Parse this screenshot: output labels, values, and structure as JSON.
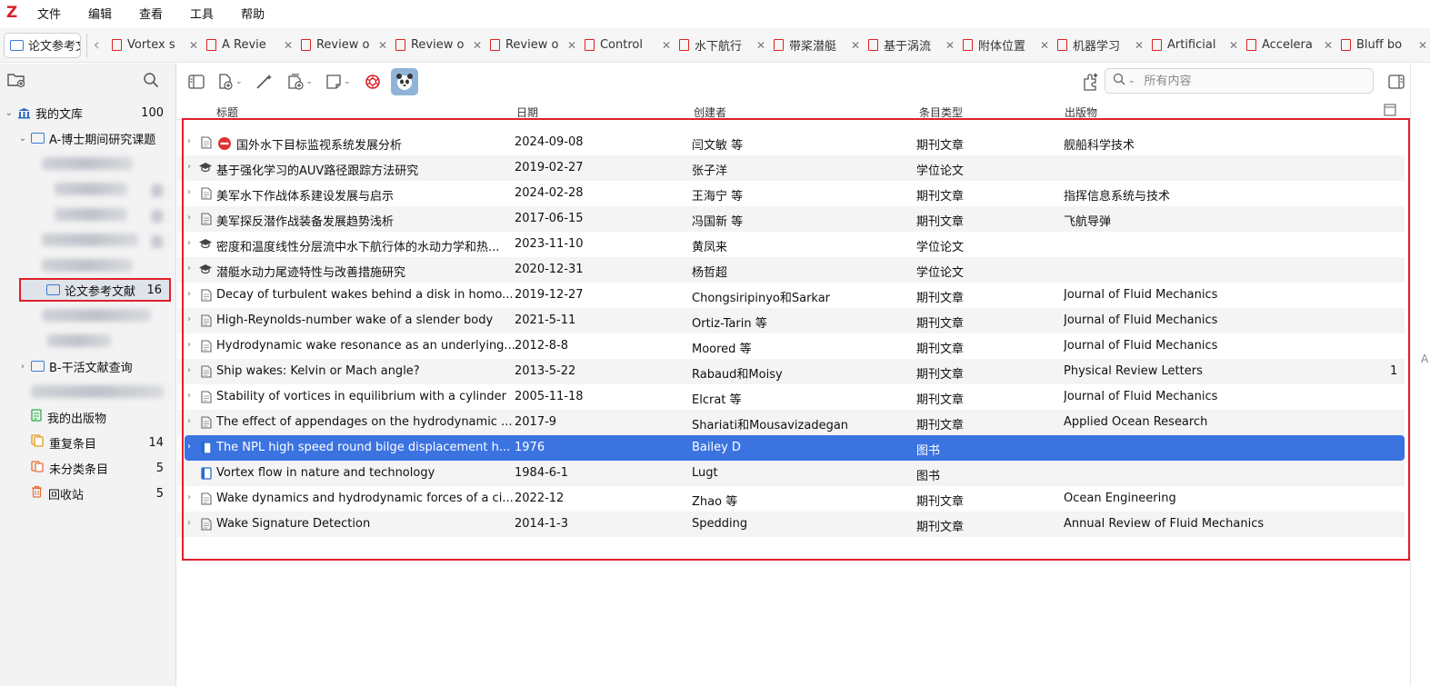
{
  "app": {
    "logo": "Z"
  },
  "menu": [
    "文件",
    "编辑",
    "查看",
    "工具",
    "帮助"
  ],
  "library_tab": {
    "label": "论文参考文"
  },
  "tabs": [
    {
      "label": "Vortex s"
    },
    {
      "label": "A Revie"
    },
    {
      "label": "Review o"
    },
    {
      "label": "Review o"
    },
    {
      "label": "Review o"
    },
    {
      "label": "Control"
    },
    {
      "label": "水下航行"
    },
    {
      "label": "带桨潜艇"
    },
    {
      "label": "基于涡流"
    },
    {
      "label": "附体位置"
    },
    {
      "label": "机器学习"
    },
    {
      "label": "Artificial"
    },
    {
      "label": "Accelera"
    },
    {
      "label": "Bluff bo"
    }
  ],
  "sidebar": {
    "my_library": {
      "label": "我的文库",
      "count": "100"
    },
    "folder_a": {
      "label": "A-博士期间研究课题"
    },
    "selected_collection": {
      "label": "论文参考文献",
      "count": "16"
    },
    "folder_b": {
      "label": "B-干活文献查询"
    },
    "my_publications": {
      "label": "我的出版物"
    },
    "duplicates": {
      "label": "重复条目",
      "count": "14"
    },
    "unfiled": {
      "label": "未分类条目",
      "count": "5"
    },
    "trash": {
      "label": "回收站",
      "count": "5"
    }
  },
  "search": {
    "placeholder": "所有内容"
  },
  "columns": {
    "title": "标题",
    "date": "日期",
    "creator": "创建者",
    "type": "条目类型",
    "publication": "出版物"
  },
  "items": [
    {
      "title": "国外水下目标监视系统发展分析",
      "date": "2024-09-08",
      "creator": "闫文敏 等",
      "type": "期刊文章",
      "publication": "舰船科学技术",
      "icon": "no-entry-icon"
    },
    {
      "title": "基于强化学习的AUV路径跟踪方法研究",
      "date": "2019-02-27",
      "creator": "张子洋",
      "type": "学位论文",
      "publication": "",
      "icon": "thesis-icon"
    },
    {
      "title": "美军水下作战体系建设发展与启示",
      "date": "2024-02-28",
      "creator": "王海宁 等",
      "type": "期刊文章",
      "publication": "指挥信息系统与技术",
      "icon": "document-icon"
    },
    {
      "title": "美军探反潜作战装备发展趋势浅析",
      "date": "2017-06-15",
      "creator": "冯国新 等",
      "type": "期刊文章",
      "publication": "飞航导弹",
      "icon": "document-icon"
    },
    {
      "title": "密度和温度线性分层流中水下航行体的水动力学和热...",
      "date": "2023-11-10",
      "creator": "黄凤来",
      "type": "学位论文",
      "publication": "",
      "icon": "thesis-icon"
    },
    {
      "title": "潜艇水动力尾迹特性与改善措施研究",
      "date": "2020-12-31",
      "creator": "杨哲超",
      "type": "学位论文",
      "publication": "",
      "icon": "thesis-icon"
    },
    {
      "title": "Decay of turbulent wakes behind a disk in homo...",
      "date": "2019-12-27",
      "creator": "Chongsiripinyo和Sarkar",
      "type": "期刊文章",
      "publication": "Journal of Fluid Mechanics",
      "icon": "document-icon"
    },
    {
      "title": "High-Reynolds-number wake of a slender body",
      "date": "2021-5-11",
      "creator": "Ortiz-Tarin 等",
      "type": "期刊文章",
      "publication": "Journal of Fluid Mechanics",
      "icon": "document-icon"
    },
    {
      "title": "Hydrodynamic wake resonance as an underlying...",
      "date": "2012-8-8",
      "creator": "Moored 等",
      "type": "期刊文章",
      "publication": "Journal of Fluid Mechanics",
      "icon": "document-icon"
    },
    {
      "title": "Ship wakes: Kelvin or Mach angle?",
      "date": "2013-5-22",
      "creator": "Rabaud和Moisy",
      "type": "期刊文章",
      "publication": "Physical Review Letters",
      "extra": "1",
      "icon": "document-icon"
    },
    {
      "title": "Stability of vortices in equilibrium with a cylinder",
      "date": "2005-11-18",
      "creator": "Elcrat 等",
      "type": "期刊文章",
      "publication": "Journal of Fluid Mechanics",
      "icon": "document-icon"
    },
    {
      "title": "The effect of appendages on the hydrodynamic ...",
      "date": "2017-9",
      "creator": "Shariati和Mousavizadegan",
      "type": "期刊文章",
      "publication": "Applied Ocean Research",
      "icon": "document-icon"
    },
    {
      "title": "The NPL high speed round bilge displacement h...",
      "date": "1976",
      "creator": "Bailey D",
      "type": "图书",
      "publication": "",
      "icon": "book-icon",
      "selected": true
    },
    {
      "title": "Vortex flow in nature and technology",
      "date": "1984-6-1",
      "creator": "Lugt",
      "type": "图书",
      "publication": "",
      "icon": "book-icon"
    },
    {
      "title": "Wake dynamics and hydrodynamic forces of a ci...",
      "date": "2022-12",
      "creator": "Zhao 等",
      "type": "期刊文章",
      "publication": "Ocean Engineering",
      "icon": "document-icon"
    },
    {
      "title": "Wake Signature Detection",
      "date": "2014-1-3",
      "creator": "Spedding",
      "type": "期刊文章",
      "publication": "Annual Review of Fluid Mechanics",
      "icon": "document-icon"
    }
  ],
  "right_strip": {
    "label": "A"
  },
  "colors": {
    "selection": "#3b73e0",
    "highlight_box": "#e0202a",
    "folder": "#3a7bd5",
    "logo": "#d8232a"
  }
}
